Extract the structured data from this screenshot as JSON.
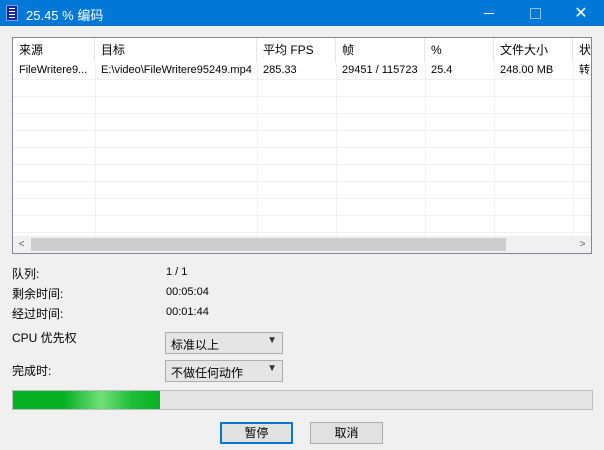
{
  "window": {
    "title": "25.45 % 编码",
    "icon": "app-film-icon"
  },
  "list": {
    "columns": [
      "来源",
      "目标",
      "平均 FPS",
      "帧",
      "%",
      "文件大小",
      "状"
    ],
    "rows": [
      {
        "source": "FileWritere9...",
        "target": "E:\\video\\FileWritere95249.mp4",
        "avg_fps": "285.33",
        "frames": "29451 / 115723",
        "percent": "25.4",
        "size": "248.00 MB",
        "status": "转"
      }
    ]
  },
  "info": {
    "queue_label": "队列:",
    "queue_value": "1 / 1",
    "remaining_label": "剩余时间:",
    "remaining_value": "00:05:04",
    "elapsed_label": "经过时间:",
    "elapsed_value": "00:01:44",
    "priority_label": "CPU 优先权",
    "priority_value": "标准以上",
    "completion_label": "完成时:",
    "completion_value": "不做任何动作"
  },
  "progress": {
    "percent": 25.45,
    "color": "#06b025"
  },
  "buttons": {
    "pause": "暂停",
    "cancel": "取消"
  },
  "colors": {
    "titlebar": "#0078d7",
    "window_bg": "#f0f0f0"
  }
}
